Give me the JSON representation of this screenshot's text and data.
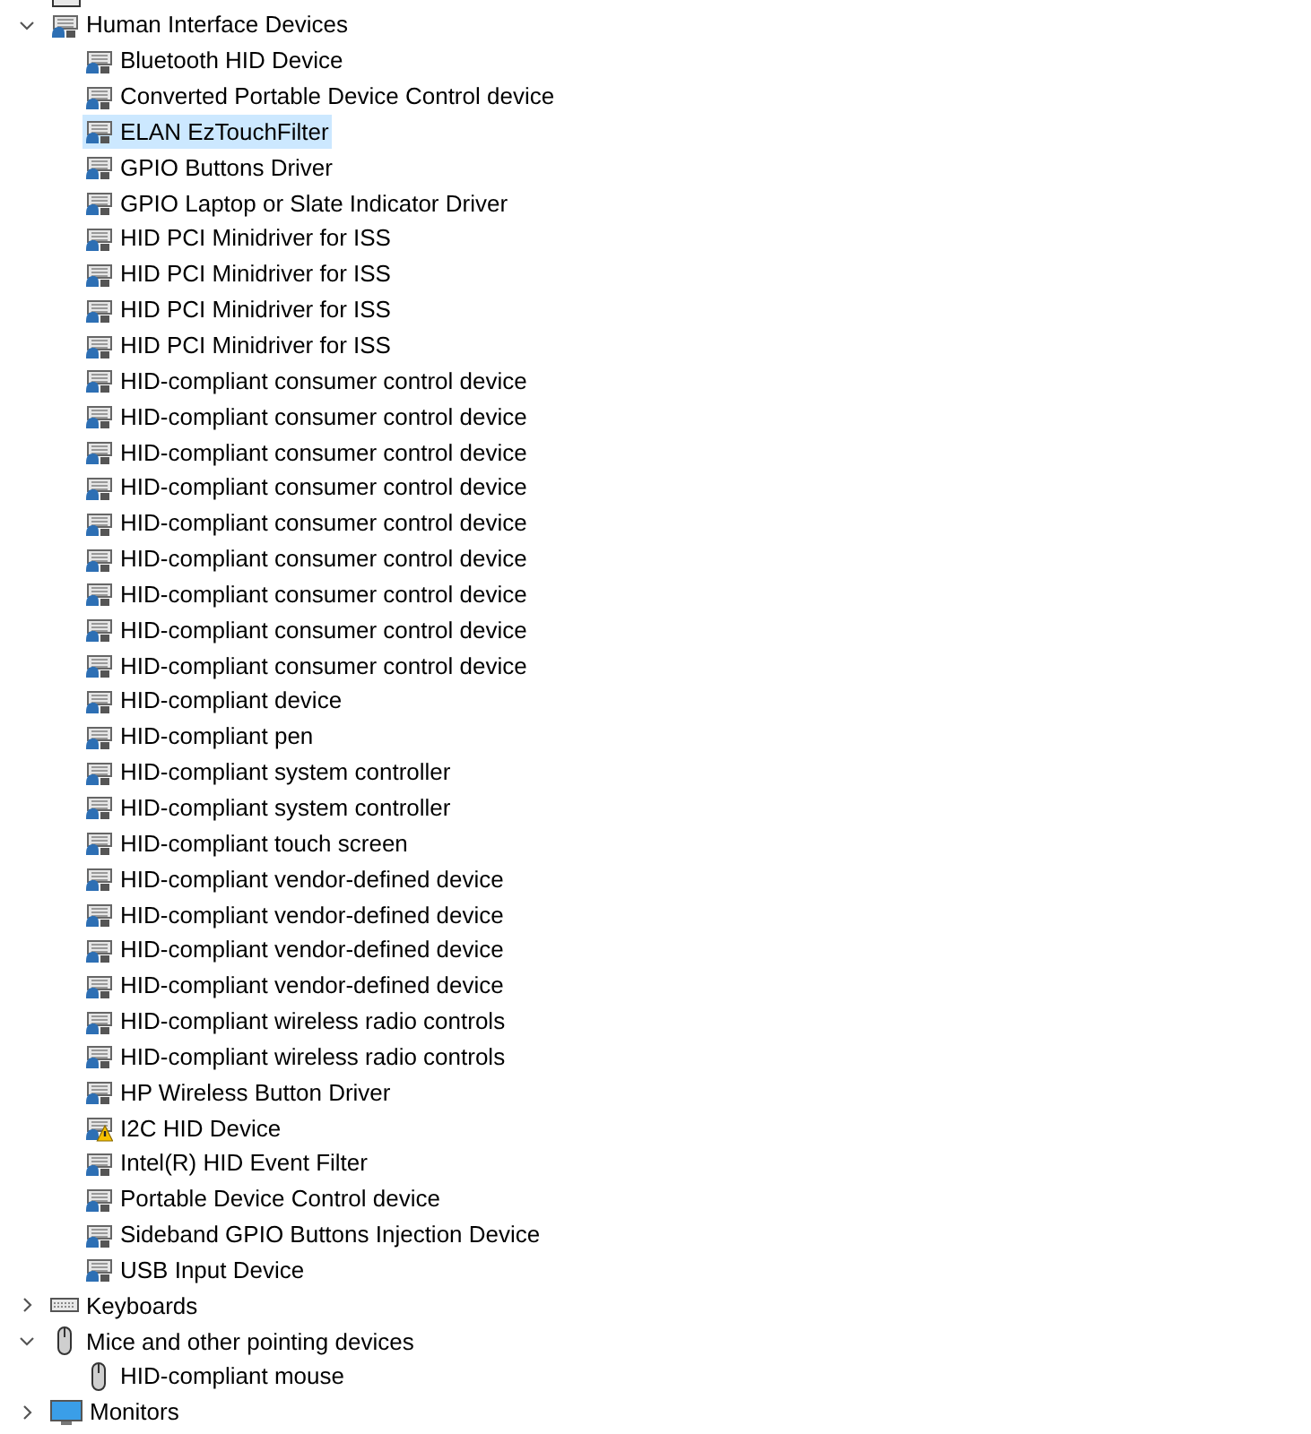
{
  "categories": [
    {
      "label": "Human Interface Devices",
      "kind": "hid",
      "expanded": true,
      "children": [
        {
          "label": "Bluetooth HID Device",
          "kind": "hid",
          "selected": false,
          "warning": false
        },
        {
          "label": "Converted Portable Device Control device",
          "kind": "hid",
          "selected": false,
          "warning": false
        },
        {
          "label": "ELAN EzTouchFilter",
          "kind": "hid",
          "selected": true,
          "warning": false
        },
        {
          "label": "GPIO Buttons Driver",
          "kind": "hid",
          "selected": false,
          "warning": false
        },
        {
          "label": "GPIO Laptop or Slate Indicator Driver",
          "kind": "hid",
          "selected": false,
          "warning": false
        },
        {
          "label": "HID PCI Minidriver for ISS",
          "kind": "hid",
          "selected": false,
          "warning": false
        },
        {
          "label": "HID PCI Minidriver for ISS",
          "kind": "hid",
          "selected": false,
          "warning": false
        },
        {
          "label": "HID PCI Minidriver for ISS",
          "kind": "hid",
          "selected": false,
          "warning": false
        },
        {
          "label": "HID PCI Minidriver for ISS",
          "kind": "hid",
          "selected": false,
          "warning": false
        },
        {
          "label": "HID-compliant consumer control device",
          "kind": "hid",
          "selected": false,
          "warning": false
        },
        {
          "label": "HID-compliant consumer control device",
          "kind": "hid",
          "selected": false,
          "warning": false
        },
        {
          "label": "HID-compliant consumer control device",
          "kind": "hid",
          "selected": false,
          "warning": false
        },
        {
          "label": "HID-compliant consumer control device",
          "kind": "hid",
          "selected": false,
          "warning": false
        },
        {
          "label": "HID-compliant consumer control device",
          "kind": "hid",
          "selected": false,
          "warning": false
        },
        {
          "label": "HID-compliant consumer control device",
          "kind": "hid",
          "selected": false,
          "warning": false
        },
        {
          "label": "HID-compliant consumer control device",
          "kind": "hid",
          "selected": false,
          "warning": false
        },
        {
          "label": "HID-compliant consumer control device",
          "kind": "hid",
          "selected": false,
          "warning": false
        },
        {
          "label": "HID-compliant consumer control device",
          "kind": "hid",
          "selected": false,
          "warning": false
        },
        {
          "label": "HID-compliant device",
          "kind": "hid",
          "selected": false,
          "warning": false
        },
        {
          "label": "HID-compliant pen",
          "kind": "hid",
          "selected": false,
          "warning": false
        },
        {
          "label": "HID-compliant system controller",
          "kind": "hid",
          "selected": false,
          "warning": false
        },
        {
          "label": "HID-compliant system controller",
          "kind": "hid",
          "selected": false,
          "warning": false
        },
        {
          "label": "HID-compliant touch screen",
          "kind": "hid",
          "selected": false,
          "warning": false
        },
        {
          "label": "HID-compliant vendor-defined device",
          "kind": "hid",
          "selected": false,
          "warning": false
        },
        {
          "label": "HID-compliant vendor-defined device",
          "kind": "hid",
          "selected": false,
          "warning": false
        },
        {
          "label": "HID-compliant vendor-defined device",
          "kind": "hid",
          "selected": false,
          "warning": false
        },
        {
          "label": "HID-compliant vendor-defined device",
          "kind": "hid",
          "selected": false,
          "warning": false
        },
        {
          "label": "HID-compliant wireless radio controls",
          "kind": "hid",
          "selected": false,
          "warning": false
        },
        {
          "label": "HID-compliant wireless radio controls",
          "kind": "hid",
          "selected": false,
          "warning": false
        },
        {
          "label": "HP Wireless Button Driver",
          "kind": "hid",
          "selected": false,
          "warning": false
        },
        {
          "label": "I2C HID Device",
          "kind": "hid",
          "selected": false,
          "warning": true
        },
        {
          "label": "Intel(R) HID Event Filter",
          "kind": "hid",
          "selected": false,
          "warning": false
        },
        {
          "label": "Portable Device Control device",
          "kind": "hid",
          "selected": false,
          "warning": false
        },
        {
          "label": "Sideband GPIO Buttons Injection Device",
          "kind": "hid",
          "selected": false,
          "warning": false
        },
        {
          "label": "USB Input Device",
          "kind": "hid",
          "selected": false,
          "warning": false
        }
      ]
    },
    {
      "label": "Keyboards",
      "kind": "keyboard",
      "expanded": false
    },
    {
      "label": "Mice and other pointing devices",
      "kind": "mouse",
      "expanded": true,
      "children": [
        {
          "label": "HID-compliant mouse",
          "kind": "mouse",
          "selected": false,
          "warning": false
        }
      ]
    },
    {
      "label": "Monitors",
      "kind": "monitor",
      "expanded": false
    }
  ]
}
